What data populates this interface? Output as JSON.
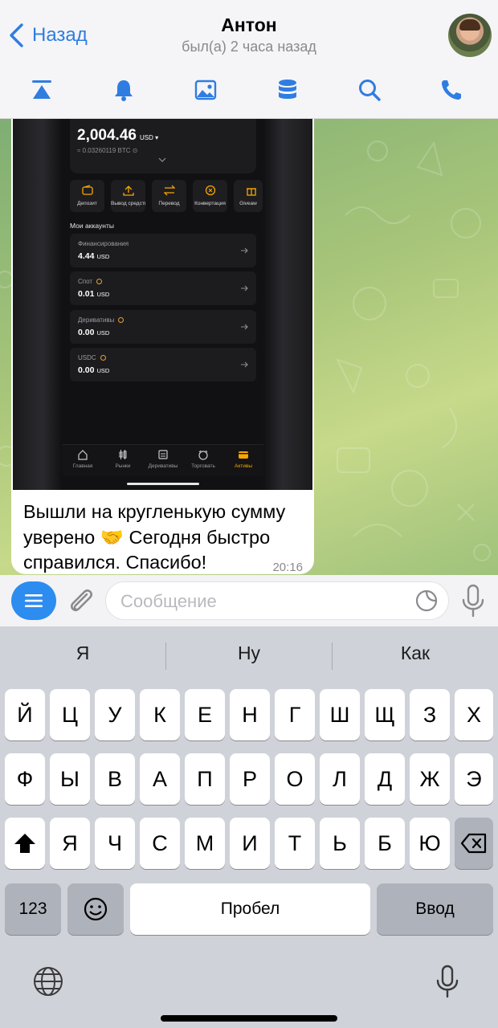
{
  "header": {
    "back_label": "Назад",
    "title": "Антон",
    "subtitle": "был(а) 2 часа назад"
  },
  "toolbar": {
    "icons": [
      "pin-top-icon",
      "bell-icon",
      "image-icon",
      "database-icon",
      "search-icon",
      "phone-icon"
    ]
  },
  "message": {
    "screenshot": {
      "balance": "2,004.46",
      "balance_currency": "USD",
      "btc_equiv": "≈ 0.03260119 BTC",
      "actions": [
        "Депозит",
        "Вывод средств",
        "Перевод",
        "Конвертация",
        "Giveaw"
      ],
      "accounts_title": "Мои аккаунты",
      "accounts": [
        {
          "name": "Финансирования",
          "value": "4.44",
          "currency": "USD"
        },
        {
          "name": "Спот",
          "value": "0.01",
          "currency": "USD"
        },
        {
          "name": "Деривативы",
          "value": "0.00",
          "currency": "USD"
        },
        {
          "name": "USDC",
          "value": "0.00",
          "currency": "USD"
        }
      ],
      "tabs": [
        "Главная",
        "Рынки",
        "Деривативы",
        "Торговать",
        "Активы"
      ],
      "active_tab_color": "#f7a600"
    },
    "text": "Вышли на кругленькую сумму уверено 🤝 Сегодня быстро справился. Спасибо!",
    "time": "20:16"
  },
  "input": {
    "placeholder": "Сообщение"
  },
  "keyboard": {
    "suggestions": [
      "Я",
      "Ну",
      "Как"
    ],
    "row1": [
      "Й",
      "Ц",
      "У",
      "К",
      "Е",
      "Н",
      "Г",
      "Ш",
      "Щ",
      "З",
      "Х"
    ],
    "row2": [
      "Ф",
      "Ы",
      "В",
      "А",
      "П",
      "Р",
      "О",
      "Л",
      "Д",
      "Ж",
      "Э"
    ],
    "row3": [
      "Я",
      "Ч",
      "С",
      "М",
      "И",
      "Т",
      "Ь",
      "Б",
      "Ю"
    ],
    "numbers_label": "123",
    "space_label": "Пробел",
    "enter_label": "Ввод"
  },
  "colors": {
    "accent": "#2f7de1",
    "menu_button": "#2d8cf0"
  }
}
